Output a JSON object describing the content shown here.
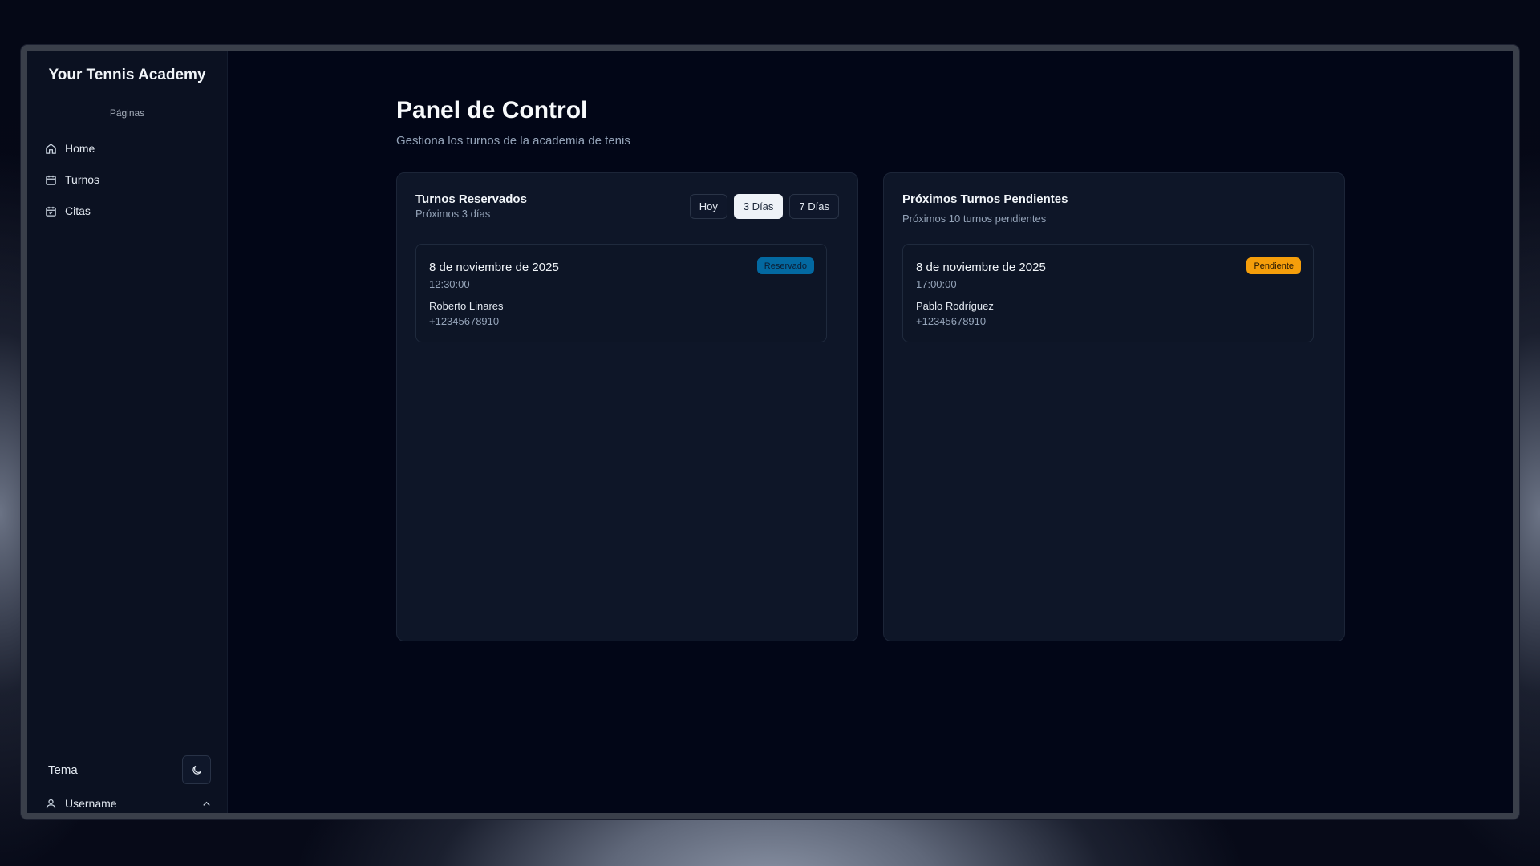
{
  "sidebar": {
    "brand": "Your Tennis Academy",
    "section_label": "Páginas",
    "items": [
      {
        "label": "Home",
        "icon": "home-icon"
      },
      {
        "label": "Turnos",
        "icon": "calendar-icon"
      },
      {
        "label": "Citas",
        "icon": "calendar-check-icon"
      }
    ],
    "theme_label": "Tema",
    "theme_icon": "moon-icon",
    "username": "Username"
  },
  "header": {
    "title": "Panel de Control",
    "subtitle": "Gestiona los turnos de la academia de tenis"
  },
  "reserved": {
    "title": "Turnos Reservados",
    "subtitle": "Próximos 3 días",
    "ranges": [
      "Hoy",
      "3 Días",
      "7 Días"
    ],
    "active_range": "3 Días",
    "items": [
      {
        "date": "8 de noviembre de 2025",
        "time": "12:30:00",
        "name": "Roberto Linares",
        "phone": "+12345678910",
        "status": "Reservado"
      }
    ]
  },
  "pending": {
    "title": "Próximos Turnos Pendientes",
    "subtitle": "Próximos 10 turnos pendientes",
    "items": [
      {
        "date": "8 de noviembre de 2025",
        "time": "17:00:00",
        "name": "Pablo Rodríguez",
        "phone": "+12345678910",
        "status": "Pendiente"
      }
    ]
  },
  "colors": {
    "reserved_badge": "#0369a1",
    "pending_badge": "#f59e0b",
    "background": "#020617"
  }
}
